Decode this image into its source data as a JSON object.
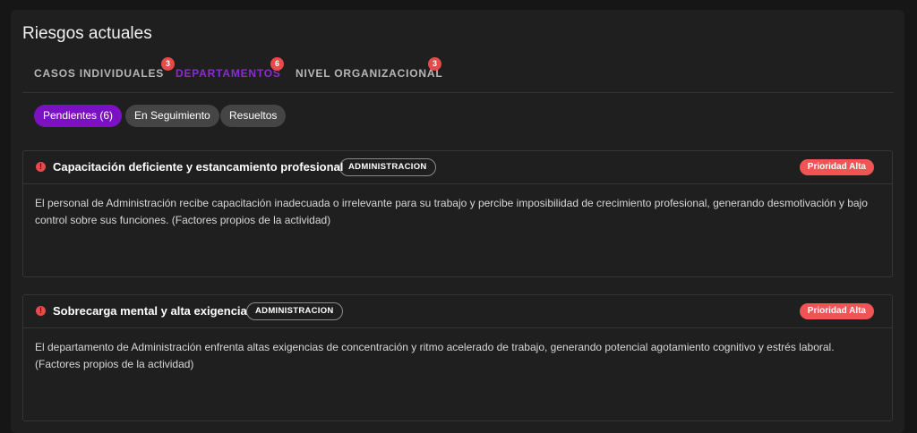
{
  "page": {
    "title": "Riesgos actuales"
  },
  "tabs": [
    {
      "label": "CASOS INDIVIDUALES",
      "count": "3",
      "active": false
    },
    {
      "label": "DEPARTAMENTOS",
      "count": "6",
      "active": true
    },
    {
      "label": "NIVEL ORGANIZACIONAL",
      "count": "3",
      "active": false
    }
  ],
  "filters": [
    {
      "label": "Pendientes (6)",
      "active": true
    },
    {
      "label": "En Seguimiento",
      "active": false
    },
    {
      "label": "Resueltos",
      "active": false
    }
  ],
  "risks": [
    {
      "icon": "alert-circle-icon",
      "title": "Capacitación deficiente y estancamiento profesional",
      "department": "ADMINISTRACION",
      "priority": "Prioridad Alta",
      "description": "El personal de Administración recibe capacitación inadecuada o irrelevante para su trabajo y percibe imposibilidad de crecimiento profesional, generando desmotivación y bajo control sobre sus funciones. (Factores propios de la actividad)"
    },
    {
      "icon": "alert-circle-icon",
      "title": "Sobrecarga mental y alta exigencia",
      "department": "ADMINISTRACION",
      "priority": "Prioridad Alta",
      "description": "El departamento de Administración enfrenta altas exigencias de concentración y ritmo acelerado de trabajo, generando potencial agotamiento cognitivo y estrés laboral. (Factores propios de la actividad)"
    }
  ],
  "colors": {
    "accent": "#7a12c4",
    "tab_active": "#8b2bd1",
    "priority": "#f05454",
    "badge": "#e84a4a"
  }
}
